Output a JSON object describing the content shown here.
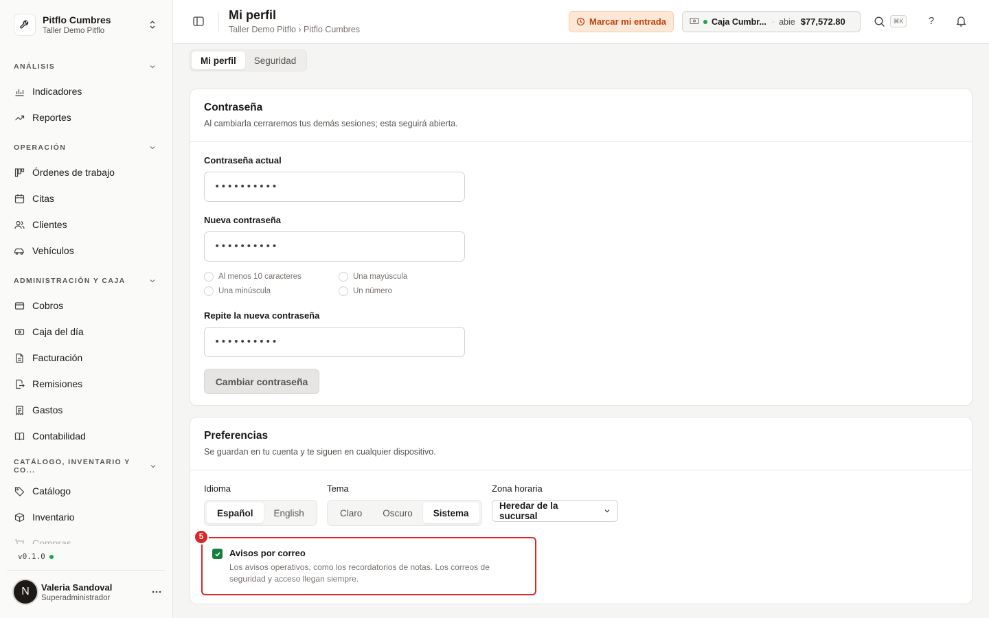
{
  "brand": {
    "title": "Pitflo Cumbres",
    "subtitle": "Taller Demo Pitflo"
  },
  "sidebar": {
    "sections": [
      {
        "title": "ANÁLISIS",
        "items": [
          "Indicadores",
          "Reportes"
        ]
      },
      {
        "title": "OPERACIÓN",
        "items": [
          "Órdenes de trabajo",
          "Citas",
          "Clientes",
          "Vehículos"
        ]
      },
      {
        "title": "ADMINISTRACIÓN Y CAJA",
        "items": [
          "Cobros",
          "Caja del día",
          "Facturación",
          "Remisiones",
          "Gastos",
          "Contabilidad"
        ]
      },
      {
        "title": "CATÁLOGO, INVENTARIO Y CO...",
        "items": [
          "Catálogo",
          "Inventario",
          "Compras"
        ]
      }
    ],
    "version": "v0.1.0",
    "user": {
      "initial": "N",
      "name": "Valeria Sandoval",
      "role": "Superadministrador"
    }
  },
  "header": {
    "title": "Mi perfil",
    "breadcrumb": "Taller Demo Pitflo › Pitflo Cumbres",
    "clock_in_label": "Marcar mi entrada",
    "register": {
      "name": "Caja Cumbr...",
      "status": "abie",
      "amount": "$77,572.80"
    },
    "shortcut": "⌘K",
    "help": "?"
  },
  "tabs": [
    "Mi perfil",
    "Seguridad"
  ],
  "password_card": {
    "title": "Contraseña",
    "description": "Al cambiarla cerraremos tus demás sesiones; esta seguirá abierta.",
    "current_label": "Contraseña actual",
    "current_value": "••••••••••",
    "new_label": "Nueva contraseña",
    "new_value": "••••••••••",
    "requirements": [
      "Al menos 10 caracteres",
      "Una mayúscula",
      "Una minúscula",
      "Un número"
    ],
    "repeat_label": "Repite la nueva contraseña",
    "repeat_value": "••••••••••",
    "submit_label": "Cambiar contraseña"
  },
  "preferences_card": {
    "title": "Preferencias",
    "description": "Se guardan en tu cuenta y te siguen en cualquier dispositivo.",
    "language_label": "Idioma",
    "language_options": [
      "Español",
      "English"
    ],
    "theme_label": "Tema",
    "theme_options": [
      "Claro",
      "Oscuro",
      "Sistema"
    ],
    "timezone_label": "Zona horaria",
    "timezone_value": "Heredar de la sucursal",
    "highlight_badge": "5",
    "email_title": "Avisos por correo",
    "email_description": "Los avisos operativos, como los recordatorios de notas. Los correos de seguridad y acceso llegan siempre."
  },
  "colors": {
    "accent_orange": "#c2410c",
    "status_green": "#16a34a",
    "checkbox_green": "#15803d",
    "highlight_red": "#dc2626"
  }
}
